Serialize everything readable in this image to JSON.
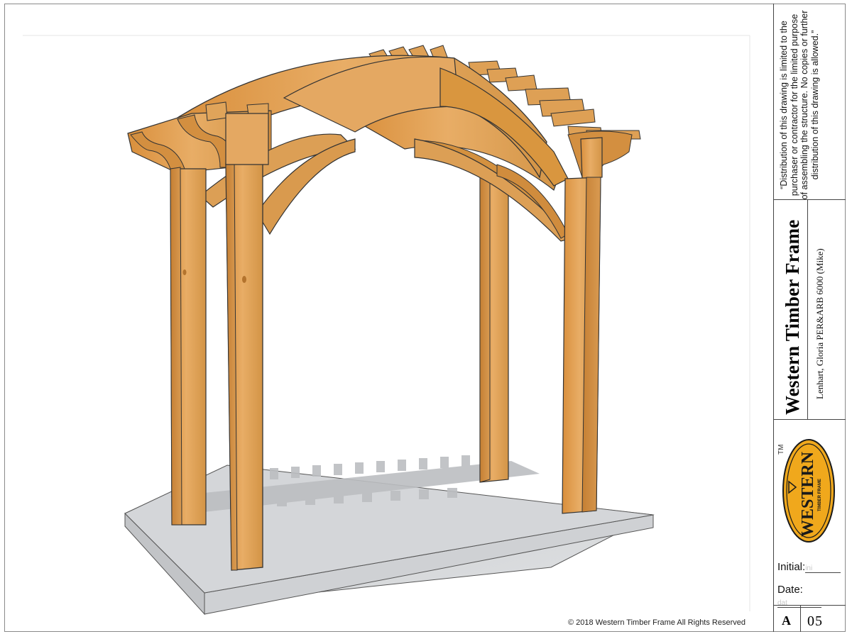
{
  "title_block": {
    "notice": "“Distribution of this drawing is limited to the purchaser or contractor for the limited purpose of assembling the structure.  No copies or further distribution of this drawing is allowed.”",
    "company_name": "Western Timber Frame",
    "project_name": "Lenhart, Gloria PER&ARB 6000 (Mike)",
    "trademark": "TM",
    "logo": {
      "wordmark": "WESTERN",
      "sub": "TIMBER FRAME",
      "colors": {
        "fill": "#f0a81c",
        "ink": "#1a1a1a"
      }
    },
    "initial_label": "Initial:",
    "initial_value": "ini",
    "date_label": "Date:",
    "date_value": "dat",
    "sheet_letter": "A",
    "sheet_number": "05"
  },
  "footer": {
    "copyright": "© 2018 Western Timber Frame All Rights Reserved"
  },
  "colors": {
    "timber": "#e0a45a",
    "timber_dark": "#c9883e",
    "slab": "#d3d5d8",
    "slab_edge": "#b7b9bc",
    "shadow": "#c0c2c5"
  }
}
